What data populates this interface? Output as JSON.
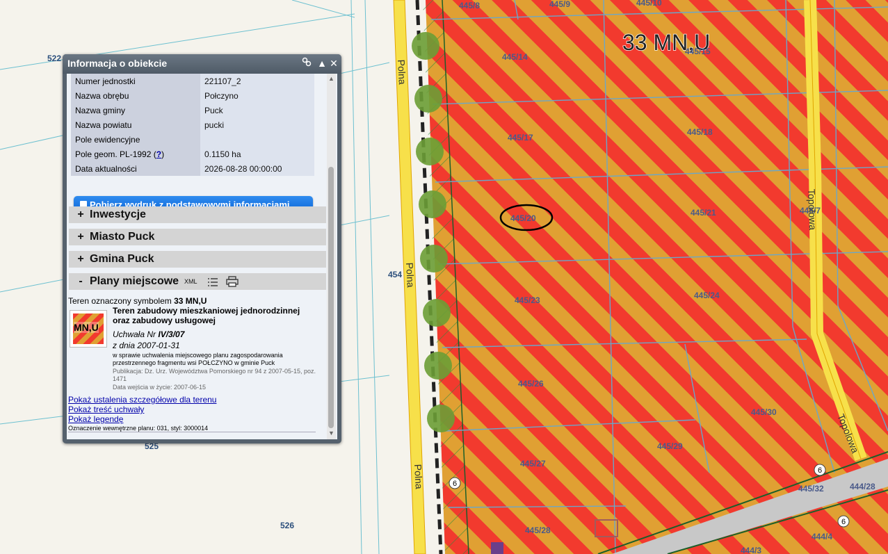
{
  "map": {
    "zone_label": "33 MN,U",
    "street_labels": [
      "Polna",
      "Polna",
      "Polna",
      "Topolowa",
      "Topolowa"
    ],
    "parcel_labels": [
      "445/8",
      "445/9",
      "445/10",
      "445/14",
      "445/15",
      "445/17",
      "445/18",
      "445/20",
      "445/21",
      "445/23",
      "445/24",
      "445/26",
      "445/27",
      "445/28",
      "445/29",
      "445/30",
      "445/32",
      "445/7",
      "444/28",
      "444/3",
      "444/4"
    ],
    "left_labels": [
      "522",
      "454",
      "525",
      "526"
    ],
    "road_marks": [
      "6",
      "6",
      "6"
    ],
    "colors": {
      "red": "#f23a2e",
      "orange": "#e0a033",
      "road": "#f7e04a",
      "background": "#f5f3ec",
      "grey_road": "#c8c8c8"
    }
  },
  "panel": {
    "title": "Informacja o obiekcie",
    "icons": [
      "link-icon",
      "collapse-icon",
      "close-icon"
    ],
    "attributes": [
      {
        "key": "Numer jednostki",
        "value": "221107_2"
      },
      {
        "key": "Nazwa obrębu",
        "value": "Połczyno"
      },
      {
        "key": "Nazwa gminy",
        "value": "Puck"
      },
      {
        "key": "Nazwa powiatu",
        "value": "pucki"
      },
      {
        "key": "Pole ewidencyjne",
        "value": ""
      },
      {
        "key": "Pole geom. PL-1992",
        "help": "?",
        "value": "0.1150 ha"
      },
      {
        "key": "Data aktualności",
        "value": "2026-08-28 00:00:00"
      }
    ],
    "print_button": "Pobierz wydruk z podstawowymi informacjami",
    "sections": [
      {
        "sign": "+",
        "label": "Inwestycje"
      },
      {
        "sign": "+",
        "label": "Miasto Puck"
      },
      {
        "sign": "+",
        "label": "Gmina Puck"
      },
      {
        "sign": "-",
        "label": "Plany miejscowe",
        "xml": "XML"
      }
    ],
    "plan": {
      "intro": "Teren oznaczony symbolem",
      "symbol": "33",
      "symbol_suffix": "MN,U",
      "badge": "MN,U",
      "description": "Teren zabudowy mieszkaniowej jednorodzinnej oraz zabudowy usługowej",
      "resolution_prefix": "Uchwała Nr",
      "resolution_no": "IV/3/07",
      "date_line": "z dnia 2007-01-31",
      "subject": "w sprawie uchwalenia miejscowego planu zagospodarowania przestrzennego fragmentu wsi POŁCZYNO w gminie Puck",
      "publication": "Publikacja: Dz. Urz. Województwa Pomorskiego nr 94 z 2007-05-15, poz. 1471",
      "effective": "Data wejścia w życie: 2007-06-15",
      "links": [
        "Pokaż ustalenia szczegółowe dla terenu",
        "Pokaż treść uchwały",
        "Pokaż legendę"
      ],
      "internal": "Oznaczenie wewnętrzne planu: 031, styl: 3000014"
    }
  }
}
